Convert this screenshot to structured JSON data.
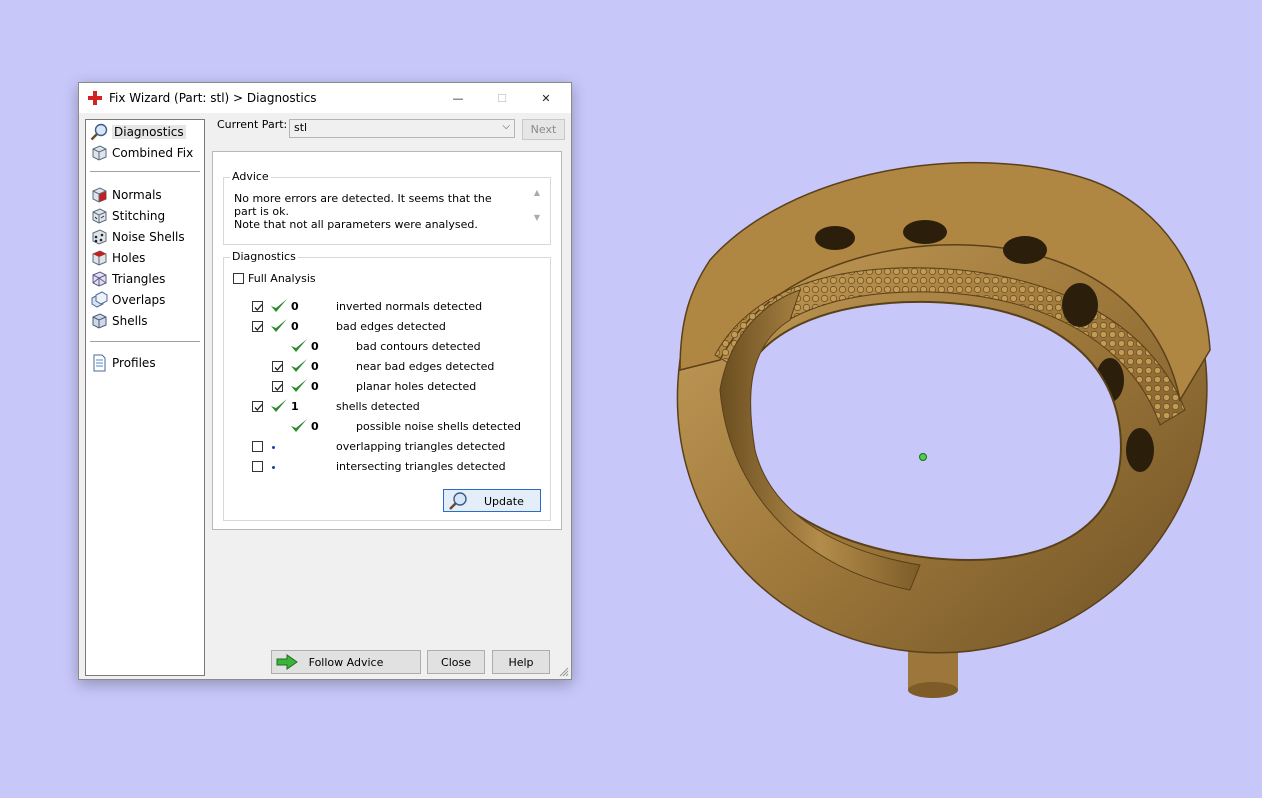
{
  "window": {
    "title": "Fix Wizard (Part: stl) > Diagnostics",
    "minimize_glyph": "—",
    "maximize_glyph": "☐",
    "close_glyph": "✕"
  },
  "nav": {
    "items": [
      {
        "label": "Diagnostics",
        "icon": "magnifier-icon",
        "selected": true
      },
      {
        "label": "Combined Fix",
        "icon": "cube-icon"
      },
      {
        "label": "Normals",
        "icon": "normals-cube-icon"
      },
      {
        "label": "Stitching",
        "icon": "stitching-cube-icon"
      },
      {
        "label": "Noise Shells",
        "icon": "noise-shells-icon"
      },
      {
        "label": "Holes",
        "icon": "holes-cube-icon"
      },
      {
        "label": "Triangles",
        "icon": "triangles-cube-icon"
      },
      {
        "label": "Overlaps",
        "icon": "overlaps-icon"
      },
      {
        "label": "Shells",
        "icon": "shells-cube-icon"
      },
      {
        "label": "Profiles",
        "icon": "document-icon"
      }
    ]
  },
  "current_part": {
    "label": "Current Part:",
    "value": "stl",
    "next_label": "Next"
  },
  "advice": {
    "title": "Advice",
    "line1": "No more errors are detected. It seems that the part is ok.",
    "line2": "Note that not all parameters were analysed."
  },
  "diagnostics": {
    "title": "Diagnostics",
    "full_analysis_label": "Full Analysis",
    "full_analysis_checked": false,
    "rows": [
      {
        "checked": true,
        "status": "ok",
        "count": "0",
        "label": "inverted normals detected"
      },
      {
        "checked": true,
        "status": "ok",
        "count": "0",
        "label": "bad edges detected"
      },
      {
        "checked": null,
        "status": "ok",
        "count": "0",
        "label": "bad contours detected"
      },
      {
        "checked": true,
        "status": "ok",
        "count": "0",
        "label": "near bad edges detected"
      },
      {
        "checked": true,
        "status": "ok",
        "count": "0",
        "label": "planar holes detected"
      },
      {
        "checked": true,
        "status": "ok",
        "count": "1",
        "label": "shells detected"
      },
      {
        "checked": null,
        "status": "ok",
        "count": "0",
        "label": "possible noise shells detected"
      },
      {
        "checked": false,
        "status": "unknown",
        "count": "",
        "label": "overlapping triangles detected"
      },
      {
        "checked": false,
        "status": "unknown",
        "count": "",
        "label": "intersecting triangles detected"
      }
    ],
    "update_label": "Update"
  },
  "buttons": {
    "follow_advice": "Follow Advice",
    "close": "Close",
    "help": "Help"
  },
  "colors": {
    "background": "#c7c7fa",
    "ring_gold": "#a07a3c",
    "check_green": "#2f8a2f",
    "accent_blue": "#2a6cc8"
  }
}
